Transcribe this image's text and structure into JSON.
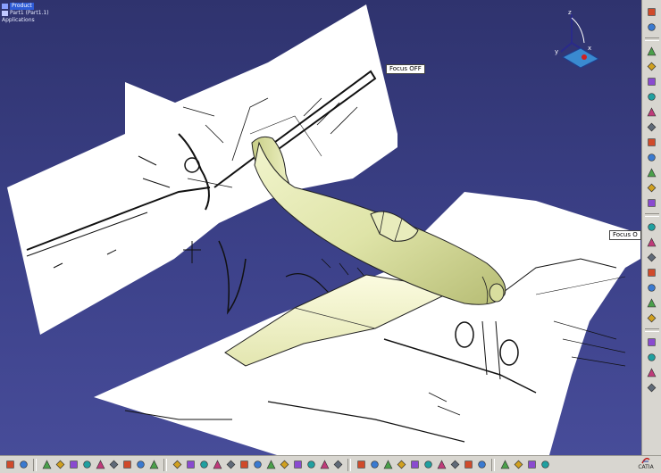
{
  "tree": {
    "product": "Product",
    "part": "Part1 (Part1.1)",
    "applications": "Applications"
  },
  "tags": {
    "focus_left": "Focus OFF",
    "focus_right": "Focus O"
  },
  "compass": {
    "x": "x",
    "y": "y",
    "z": "z"
  },
  "branding": {
    "app_name": "CATIA"
  },
  "right_toolbar": {
    "icons": [
      "select-icon",
      "fly-icon",
      "measure-icon",
      "material-icon",
      "image-icon",
      "parameter-icon",
      "formula-icon",
      "constraint-icon",
      "knowledge-icon",
      "scan-icon",
      "catalog-icon",
      "tablet-icon",
      "hide-icon",
      "render-icon",
      "apply-icon",
      "shading-icon",
      "section-icon",
      "clash-icon",
      "analysis-icon",
      "grid-icon",
      "snap-icon",
      "sketch-icon",
      "compass-icon",
      "view-icon"
    ]
  },
  "bottom_toolbar": {
    "groups": [
      [
        "expand-icon",
        "grid-select-icon"
      ],
      [
        "new-icon",
        "open-icon",
        "save-icon",
        "print-icon",
        "cut-icon",
        "copy-icon",
        "paste-icon",
        "undo-icon",
        "redo-icon"
      ],
      [
        "fly-mode-icon",
        "fit-all-icon",
        "pan-icon",
        "rotate-icon",
        "zoom-in-icon",
        "zoom-out-icon",
        "normal-view-icon",
        "multi-view-icon",
        "iso-view-icon",
        "shading-mode-icon",
        "hide-show-icon",
        "swap-icon",
        "quick-view-icon"
      ],
      [
        "render-style-icon",
        "light-icon",
        "environment-icon",
        "scene-icon",
        "turntable-icon",
        "camera-icon",
        "animation-icon",
        "video-icon",
        "shot-icon",
        "catalog-browser-icon"
      ],
      [
        "capture-icon",
        "album-icon",
        "split-icon",
        "sketch-tracer-icon"
      ]
    ]
  },
  "colors": {
    "background_top": "#2f336e",
    "background_bottom": "#474c99",
    "model_fill": "#e6eab8",
    "toolbar": "#d8d6d0"
  }
}
